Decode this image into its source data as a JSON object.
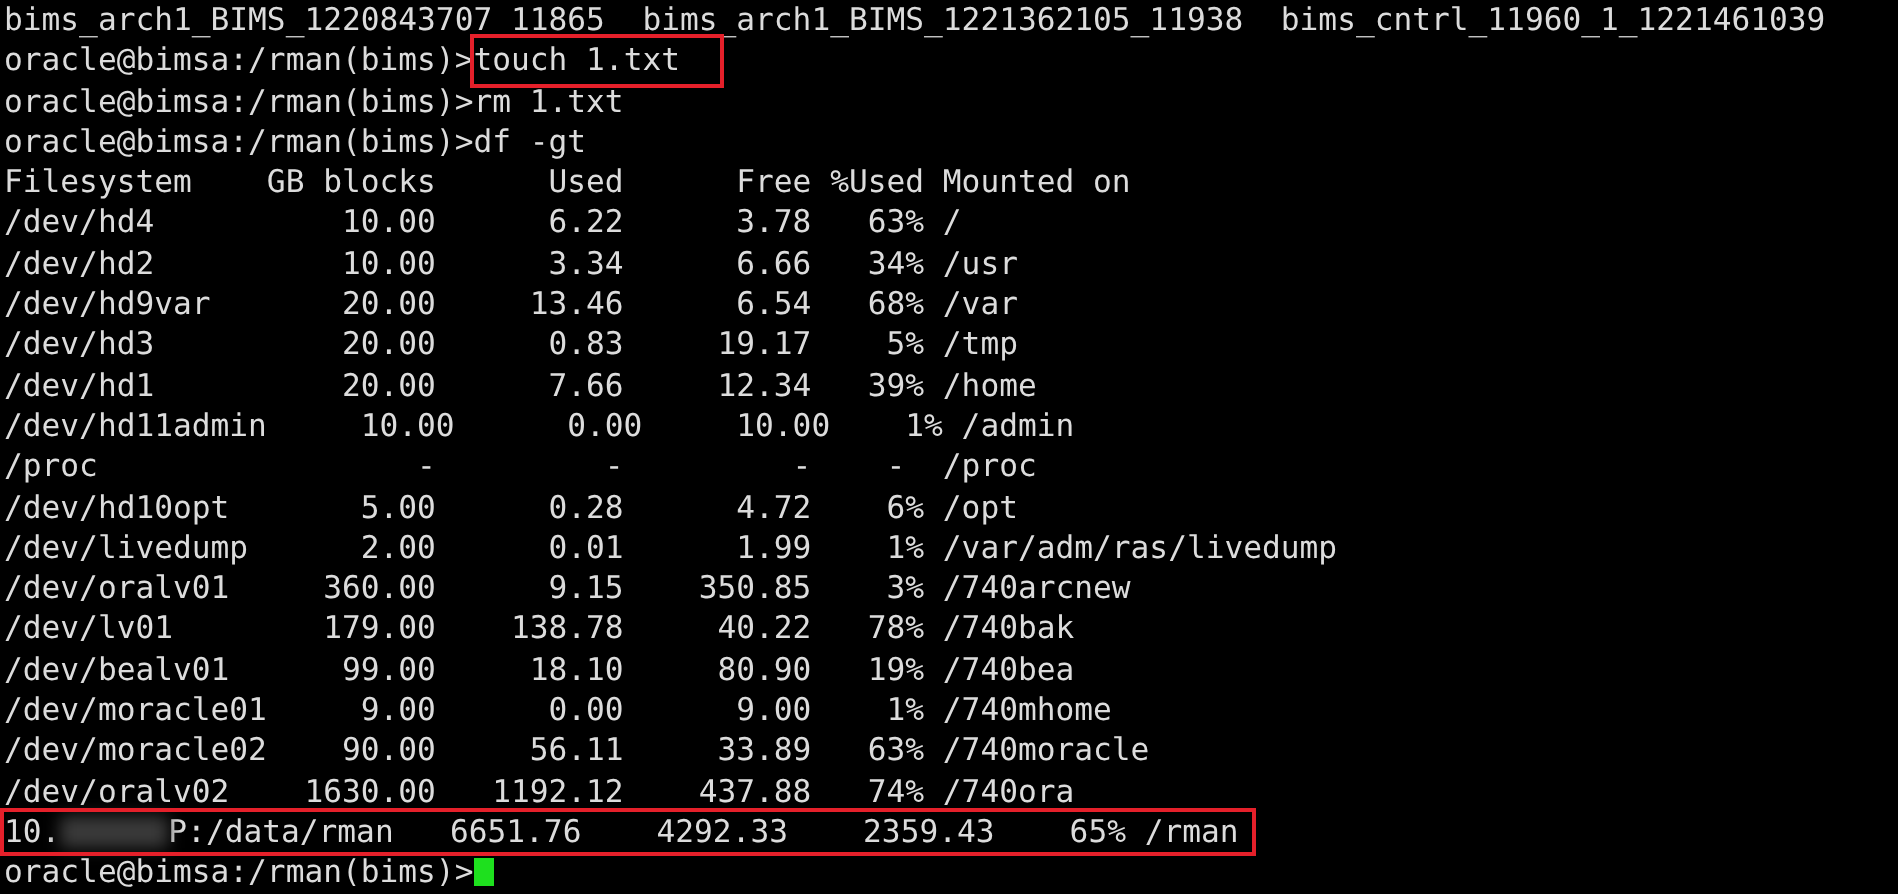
{
  "terminal": {
    "lines": [
      {
        "kind": "output",
        "text": "bims_arch1_BIMS_1220843707_11865  bims_arch1_BIMS_1221362105_11938  bims_cntrl_11960_1_1221461039",
        "highlighted": false
      },
      {
        "kind": "command",
        "prompt": "oracle@bimsa:/rman(bims)>",
        "command": "touch 1.txt",
        "highlighted": true
      },
      {
        "kind": "command",
        "prompt": "oracle@bimsa:/rman(bims)>",
        "command": "rm 1.txt",
        "highlighted": false
      },
      {
        "kind": "command",
        "prompt": "oracle@bimsa:/rman(bims)>",
        "command": "df -gt",
        "highlighted": false
      },
      {
        "kind": "output",
        "text": "Filesystem    GB blocks      Used      Free %Used Mounted on",
        "highlighted": false
      },
      {
        "kind": "output",
        "text": "/dev/hd4          10.00      6.22      3.78   63% /",
        "highlighted": false
      },
      {
        "kind": "output",
        "text": "/dev/hd2          10.00      3.34      6.66   34% /usr",
        "highlighted": false
      },
      {
        "kind": "output",
        "text": "/dev/hd9var       20.00     13.46      6.54   68% /var",
        "highlighted": false
      },
      {
        "kind": "output",
        "text": "/dev/hd3          20.00      0.83     19.17    5% /tmp",
        "highlighted": false
      },
      {
        "kind": "output",
        "text": "/dev/hd1          20.00      7.66     12.34   39% /home",
        "highlighted": false
      },
      {
        "kind": "output",
        "text": "/dev/hd11admin     10.00      0.00     10.00    1% /admin",
        "highlighted": false
      },
      {
        "kind": "output",
        "text": "/proc                 -         -         -    -  /proc",
        "highlighted": false
      },
      {
        "kind": "output",
        "text": "/dev/hd10opt       5.00      0.28      4.72    6% /opt",
        "highlighted": false
      },
      {
        "kind": "output",
        "text": "/dev/livedump      2.00      0.01      1.99    1% /var/adm/ras/livedump",
        "highlighted": false
      },
      {
        "kind": "output",
        "text": "/dev/oralv01     360.00      9.15    350.85    3% /740arcnew",
        "highlighted": false
      },
      {
        "kind": "output",
        "text": "/dev/lv01        179.00    138.78     40.22   78% /740bak",
        "highlighted": false
      },
      {
        "kind": "output",
        "text": "/dev/bealv01      99.00     18.10     80.90   19% /740bea",
        "highlighted": false
      },
      {
        "kind": "output",
        "text": "/dev/moracle01     9.00      0.00      9.00    1% /740mhome",
        "highlighted": false
      },
      {
        "kind": "output",
        "text": "/dev/moracle02    90.00     56.11     33.89   63% /740moracle",
        "highlighted": false
      },
      {
        "kind": "output",
        "text": "/dev/oralv02    1630.00   1192.12    437.88   74% /740ora",
        "highlighted": false
      },
      {
        "kind": "redacted",
        "before": "10.",
        "after": "P:/data/rman   6651.76    4292.33    2359.43    65% /rman",
        "highlighted": true
      },
      {
        "kind": "prompt",
        "prompt": "oracle@bimsa:/rman(bims)>",
        "cursor": true
      }
    ]
  }
}
